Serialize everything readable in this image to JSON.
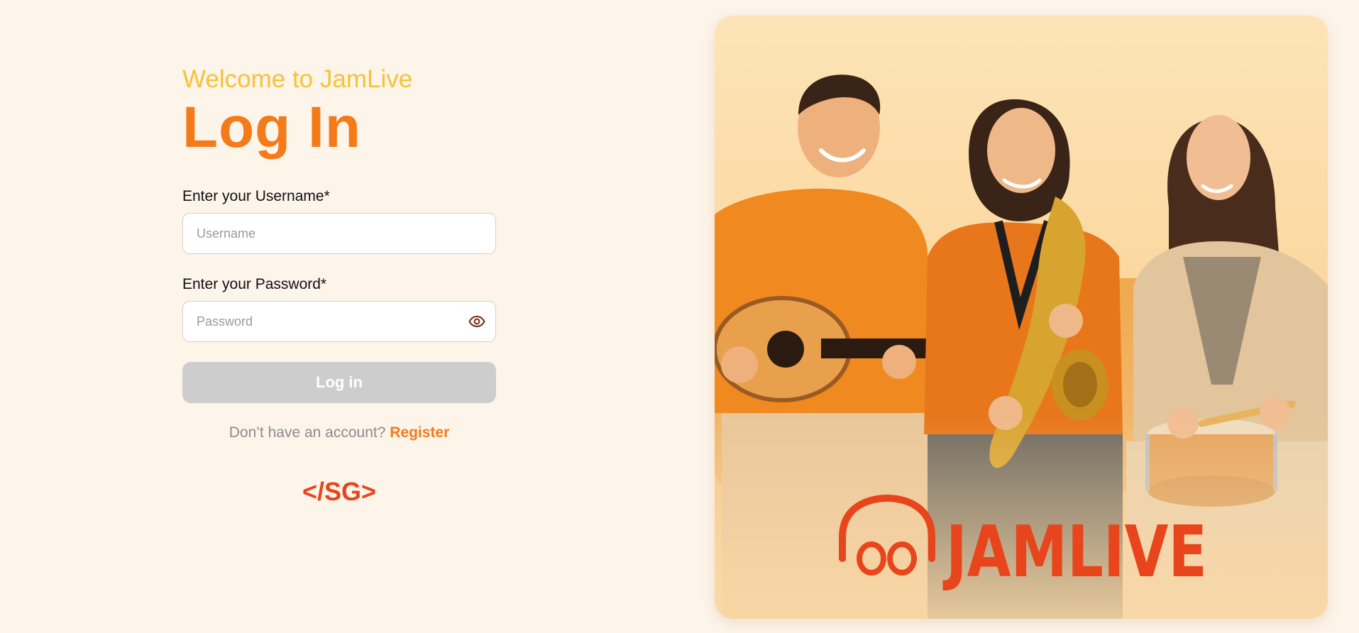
{
  "login": {
    "welcome": "Welcome to JamLive",
    "title": "Log In",
    "username_label": "Enter your Username*",
    "username_placeholder": "Username",
    "password_label": "Enter your Password*",
    "password_placeholder": "Password",
    "submit_label": "Log in",
    "no_account_text": "Don’t have an account?",
    "register_label": "Register",
    "footer_logo_text": "</SG>"
  },
  "hero": {
    "brand_text": "JAMLIVE",
    "photo": "three-musicians-guitar-saxophone-drum-on-sofa"
  },
  "icons": {
    "password_toggle": "eye-icon",
    "brand_mark": "headphones-icon"
  },
  "colors": {
    "background": "#fdf4ea",
    "welcome": "#f6c237",
    "accent": "#f57a1a",
    "brand_red": "#e8451c",
    "button_disabled": "#cdcdcd"
  }
}
